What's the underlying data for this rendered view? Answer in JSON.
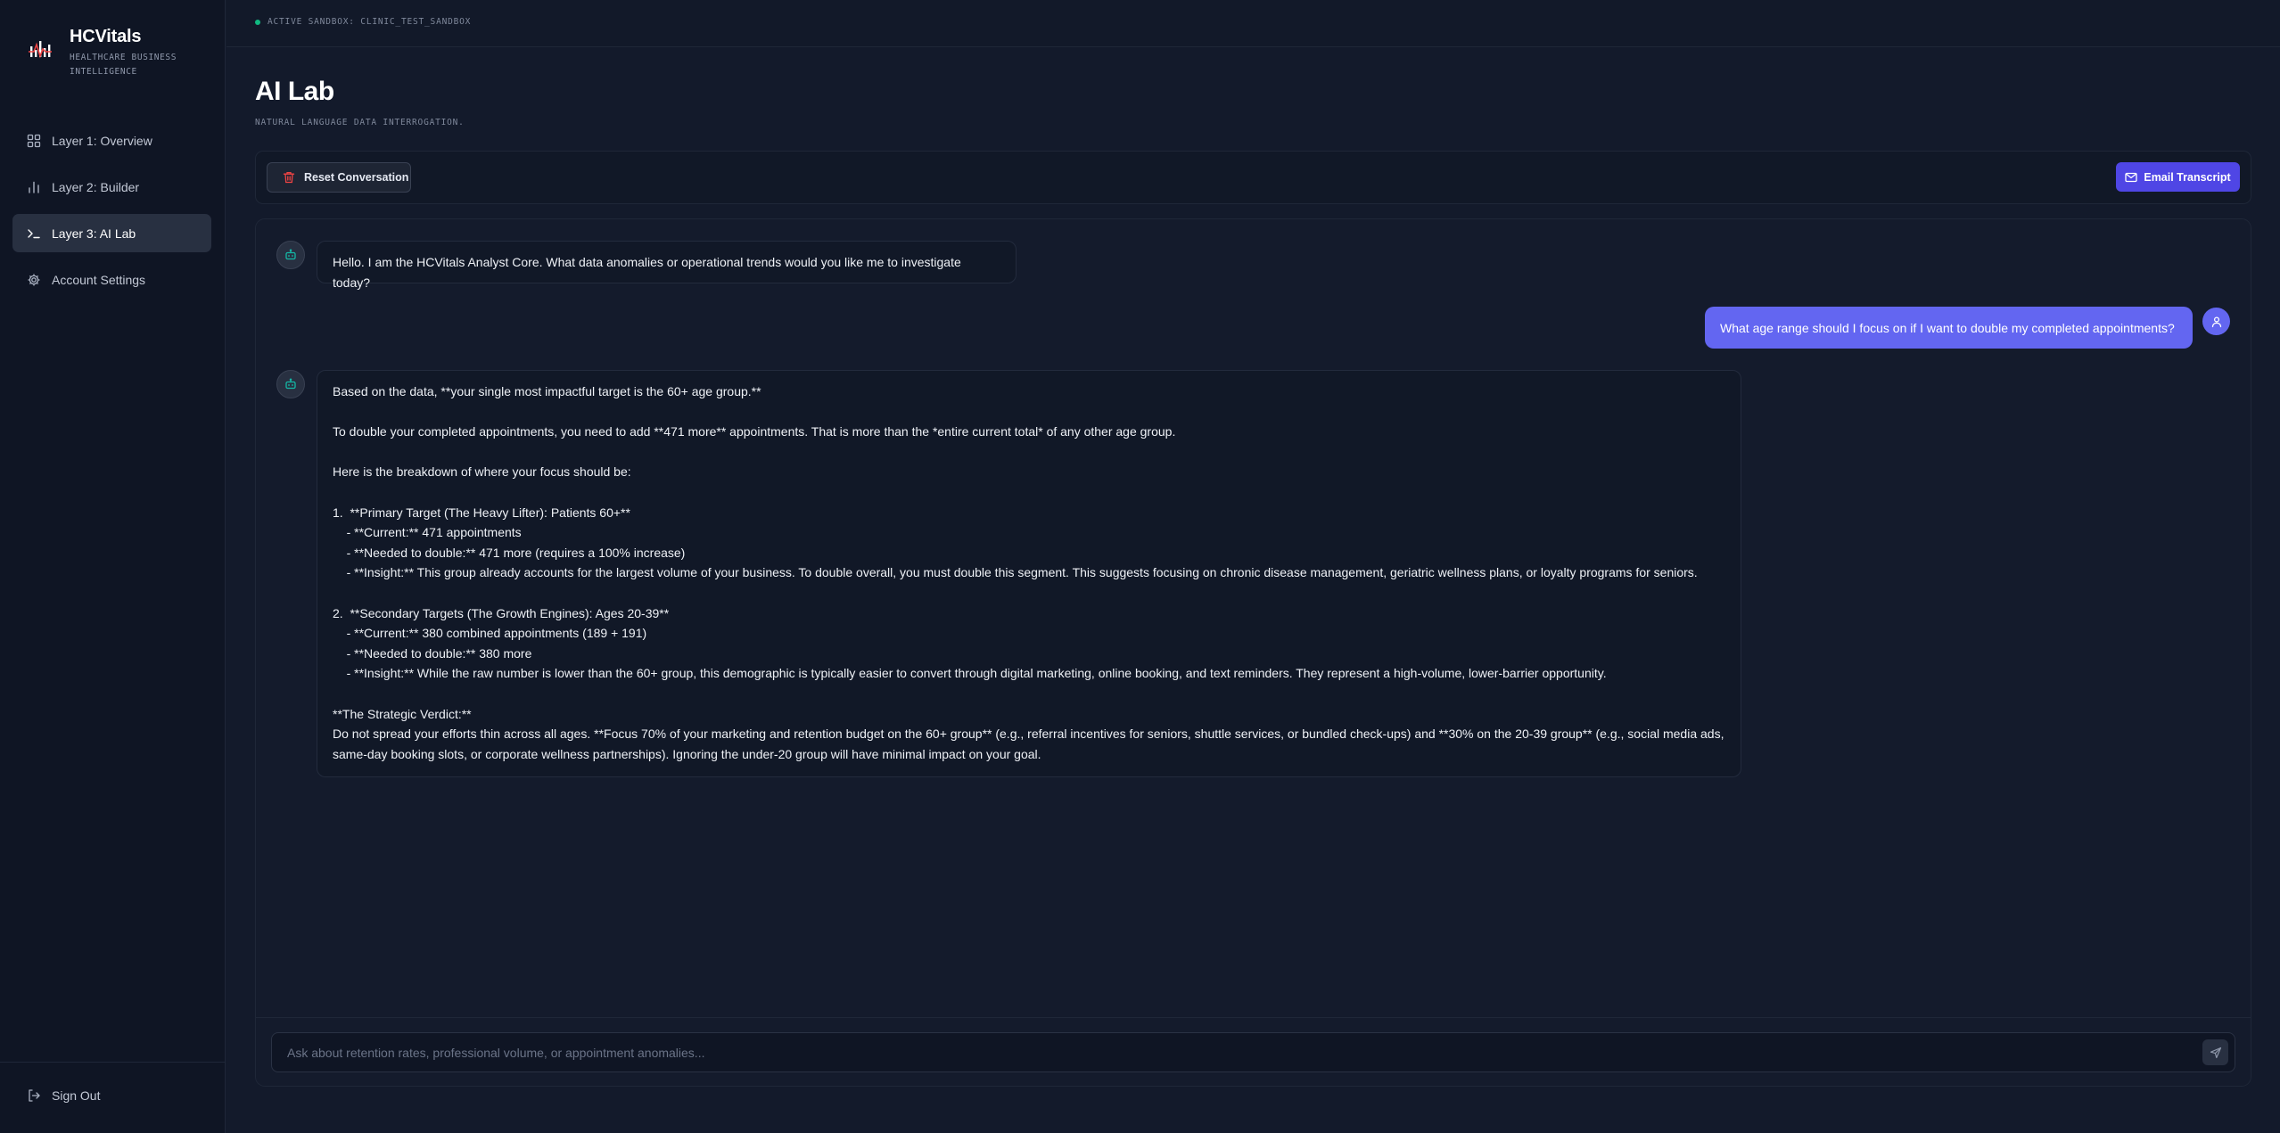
{
  "brand": {
    "name": "HCVitals",
    "subtitle": "HEALTHCARE BUSINESS INTELLIGENCE"
  },
  "nav": {
    "items": [
      {
        "label": "Layer 1: Overview",
        "icon": "grid-icon",
        "active": false
      },
      {
        "label": "Layer 2: Builder",
        "icon": "bar-chart-icon",
        "active": false
      },
      {
        "label": "Layer 3: AI Lab",
        "icon": "terminal-icon",
        "active": true
      },
      {
        "label": "Account Settings",
        "icon": "gear-icon",
        "active": false
      }
    ],
    "sign_out": "Sign Out"
  },
  "topbar": {
    "sandbox": "ACTIVE SANDBOX: CLINIC_TEST_SANDBOX"
  },
  "page": {
    "title": "AI Lab",
    "subtitle": "NATURAL LANGUAGE DATA INTERROGATION."
  },
  "toolbar": {
    "reset_label": "Reset Conversation",
    "email_label": "Email Transcript"
  },
  "chat": {
    "messages": [
      {
        "role": "assistant",
        "text": "Hello. I am the HCVitals Analyst Core. What data anomalies or operational trends would you like me to investigate today?"
      },
      {
        "role": "user",
        "text": "What age range should I focus on if I want to double my completed appointments?"
      },
      {
        "role": "assistant",
        "text": "Based on the data, **your single most impactful target is the 60+ age group.**\n\nTo double your completed appointments, you need to add **471 more** appointments. That is more than the *entire current total* of any other age group.\n\nHere is the breakdown of where your focus should be:\n\n1.  **Primary Target (The Heavy Lifter): Patients 60+**\n    - **Current:** 471 appointments\n    - **Needed to double:** 471 more (requires a 100% increase)\n    - **Insight:** This group already accounts for the largest volume of your business. To double overall, you must double this segment. This suggests focusing on chronic disease management, geriatric wellness plans, or loyalty programs for seniors.\n\n2.  **Secondary Targets (The Growth Engines): Ages 20-39**\n    - **Current:** 380 combined appointments (189 + 191)\n    - **Needed to double:** 380 more\n    - **Insight:** While the raw number is lower than the 60+ group, this demographic is typically easier to convert through digital marketing, online booking, and text reminders. They represent a high-volume, lower-barrier opportunity.\n\n**The Strategic Verdict:**\nDo not spread your efforts thin across all ages. **Focus 70% of your marketing and retention budget on the 60+ group** (e.g., referral incentives for seniors, shuttle services, or bundled check-ups) and **30% on the 20-39 group** (e.g., social media ads, same-day booking slots, or corporate wellness partnerships). Ignoring the under-20 group will have minimal impact on your goal."
      }
    ],
    "input_placeholder": "Ask about retention rates, professional volume, or appointment anomalies...",
    "input_value": ""
  },
  "colors": {
    "accent": "#4f46e5",
    "user_bubble": "#6366f1",
    "status": "#10b981",
    "bot_icon": "#14b8a6",
    "danger": "#ef4444"
  }
}
